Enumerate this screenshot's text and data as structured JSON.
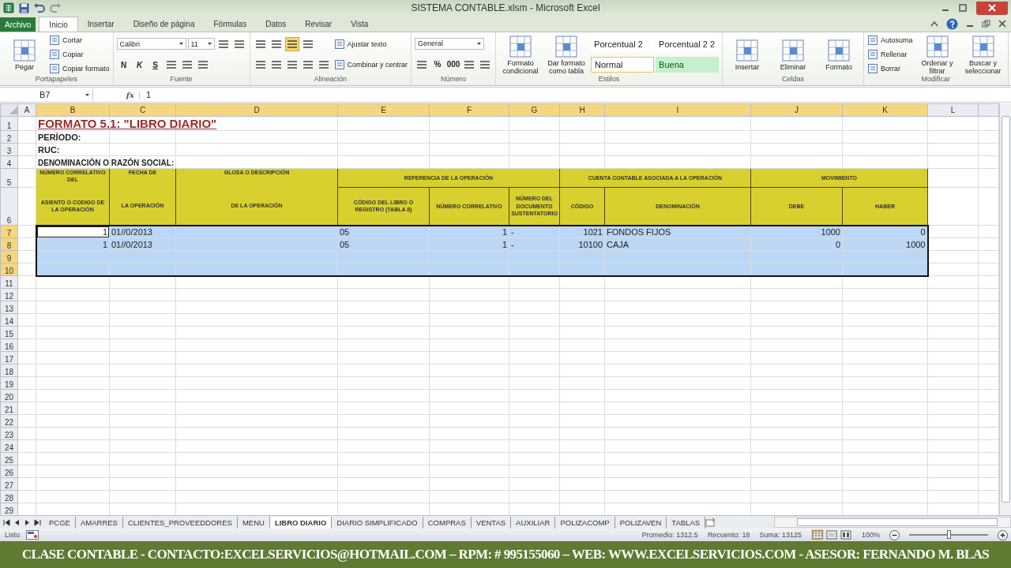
{
  "window": {
    "title": "SISTEMA CONTABLE.xlsm - Microsoft Excel"
  },
  "ribbon_tabs": [
    {
      "label": "Archivo",
      "kind": "file",
      "selected": false
    },
    {
      "label": "Inicio",
      "kind": "tab",
      "selected": true
    },
    {
      "label": "Insertar",
      "kind": "tab",
      "selected": false
    },
    {
      "label": "Diseño de página",
      "kind": "tab",
      "selected": false
    },
    {
      "label": "Fórmulas",
      "kind": "tab",
      "selected": false
    },
    {
      "label": "Datos",
      "kind": "tab",
      "selected": false
    },
    {
      "label": "Revisar",
      "kind": "tab",
      "selected": false
    },
    {
      "label": "Vista",
      "kind": "tab",
      "selected": false
    }
  ],
  "ribbon_groups": [
    {
      "label": "Portapapeles",
      "columns": [
        [
          [
            {
              "kind": "large",
              "label": "Pegar"
            }
          ]
        ],
        [
          [
            {
              "kind": "small",
              "label": "Cortar"
            }
          ],
          [
            {
              "kind": "small",
              "label": "Copiar"
            }
          ],
          [
            {
              "kind": "small",
              "label": "Copiar formato"
            }
          ]
        ]
      ]
    },
    {
      "label": "Fuente",
      "columns": [
        [
          [
            {
              "kind": "wide-field",
              "value": "Calibri"
            },
            {
              "kind": "narrow-field",
              "value": "11"
            },
            {
              "kind": "tool",
              "selected": false
            },
            {
              "kind": "tool",
              "selected": false
            }
          ],
          [
            {
              "kind": "bold-glyph",
              "label": "N",
              "selected": false
            },
            {
              "kind": "italic-glyph",
              "label": "K",
              "selected": false
            },
            {
              "kind": "underline-glyph",
              "label": "S",
              "selected": false
            },
            {
              "kind": "tool",
              "selected": false
            },
            {
              "kind": "tool",
              "selected": false
            },
            {
              "kind": "tool",
              "selected": false
            }
          ]
        ]
      ]
    },
    {
      "label": "Alineación",
      "columns": [
        [
          [
            {
              "kind": "tool",
              "selected": false
            },
            {
              "kind": "tool",
              "selected": false
            },
            {
              "kind": "tool",
              "selected": true
            },
            {
              "kind": "tool",
              "selected": false
            }
          ],
          [
            {
              "kind": "tool",
              "selected": false
            },
            {
              "kind": "tool",
              "selected": false
            },
            {
              "kind": "tool",
              "selected": false
            },
            {
              "kind": "tool",
              "selected": false
            },
            {
              "kind": "tool",
              "selected": false
            }
          ]
        ],
        [
          [
            {
              "kind": "small",
              "label": "Ajustar texto"
            }
          ],
          [
            {
              "kind": "small",
              "label": "Combinar y centrar"
            }
          ]
        ]
      ]
    },
    {
      "label": "Número",
      "columns": [
        [
          [
            {
              "kind": "wide-field",
              "value": "General"
            }
          ],
          [
            {
              "kind": "tool",
              "selected": false
            },
            {
              "kind": "bold-glyph",
              "label": "%",
              "selected": false
            },
            {
              "kind": "bold-glyph",
              "label": "000",
              "selected": false
            },
            {
              "kind": "tool",
              "selected": false
            },
            {
              "kind": "tool",
              "selected": false
            }
          ]
        ]
      ]
    },
    {
      "label": "Estilos",
      "columns": [
        [
          [
            {
              "kind": "large",
              "label": "Formato condicional"
            }
          ]
        ],
        [
          [
            {
              "kind": "large",
              "label": "Dar formato como tabla"
            }
          ]
        ],
        [
          [
            {
              "kind": "style",
              "label": "Porcentual 2",
              "selected": false
            },
            {
              "kind": "style",
              "label": "Porcentual 2 2",
              "selected": false
            }
          ],
          [
            {
              "kind": "style",
              "label": "Normal",
              "selected": true
            },
            {
              "kind": "style-good",
              "label": "Buena",
              "selected": false
            }
          ]
        ]
      ]
    },
    {
      "label": "Celdas",
      "columns": [
        [
          [
            {
              "kind": "large",
              "label": "Insertar"
            }
          ]
        ],
        [
          [
            {
              "kind": "large",
              "label": "Eliminar"
            }
          ]
        ],
        [
          [
            {
              "kind": "large",
              "label": "Formato"
            }
          ]
        ]
      ]
    },
    {
      "label": "Modificar",
      "columns": [
        [
          [
            {
              "kind": "small",
              "label": "Autosuma"
            }
          ],
          [
            {
              "kind": "small",
              "label": "Rellenar"
            }
          ],
          [
            {
              "kind": "small",
              "label": "Borrar"
            }
          ]
        ],
        [
          [
            {
              "kind": "large",
              "label": "Ordenar y filtrar"
            }
          ]
        ],
        [
          [
            {
              "kind": "large",
              "label": "Buscar y seleccionar"
            }
          ]
        ]
      ]
    }
  ],
  "formula_bar": {
    "name_box": "B7",
    "function_label": "fx",
    "formula": "1"
  },
  "sheet": {
    "columns": [
      {
        "letter": "A",
        "selected": false
      },
      {
        "letter": "B",
        "selected": true
      },
      {
        "letter": "C",
        "selected": true
      },
      {
        "letter": "D",
        "selected": true
      },
      {
        "letter": "E",
        "selected": true
      },
      {
        "letter": "F",
        "selected": true
      },
      {
        "letter": "G",
        "selected": true
      },
      {
        "letter": "H",
        "selected": true
      },
      {
        "letter": "I",
        "selected": true
      },
      {
        "letter": "J",
        "selected": true
      },
      {
        "letter": "K",
        "selected": true
      },
      {
        "letter": "L",
        "selected": false
      }
    ],
    "rows": [
      {
        "number": "1",
        "kind": "plain",
        "selected": false,
        "cells": [
          {
            "kind": "empty"
          },
          {
            "kind": "title",
            "text": "FORMATO 5.1: \"LIBRO DIARIO\""
          }
        ]
      },
      {
        "number": "2",
        "kind": "plain",
        "selected": false,
        "cells": [
          {
            "kind": "empty"
          },
          {
            "kind": "label",
            "text": "PERÍODO:"
          }
        ]
      },
      {
        "number": "3",
        "kind": "plain",
        "selected": false,
        "cells": [
          {
            "kind": "empty"
          },
          {
            "kind": "label",
            "text": "RUC:"
          }
        ]
      },
      {
        "number": "4",
        "kind": "plain",
        "selected": false,
        "cells": [
          {
            "kind": "empty"
          },
          {
            "kind": "label-small",
            "text": "DENOMINACIÓN O RAZÓN SOCIAL:"
          }
        ]
      },
      {
        "number": "5",
        "kind": "header-top",
        "selected": false,
        "cells": [
          {
            "kind": "empty"
          },
          {
            "kind": "header-top",
            "text": "NÚMERO CORRELATIVO DEL"
          },
          {
            "kind": "header-top",
            "text": "FECHA DE"
          },
          {
            "kind": "header-top",
            "text": "GLOSA O DESCRIPCIÓN"
          },
          {
            "kind": "group-start",
            "text": "REFERENCIA DE LA OPERACIÓN"
          },
          {
            "kind": "group-mid"
          },
          {
            "kind": "group-end"
          },
          {
            "kind": "group-start",
            "text": "CUENTA CONTABLE ASOCIADA A LA OPERACIÓN"
          },
          {
            "kind": "group-end"
          },
          {
            "kind": "group-start",
            "text": "MOVIMIENTO"
          },
          {
            "kind": "group-end"
          }
        ]
      },
      {
        "number": "6",
        "kind": "header",
        "selected": false,
        "cells": [
          {
            "kind": "empty"
          },
          {
            "kind": "header-bottom",
            "text": "ASIENTO O CODIGO DE LA OPERACIÓN"
          },
          {
            "kind": "header-bottom",
            "text": "LA OPERACIÓN"
          },
          {
            "kind": "header-bottom",
            "text": "DE LA OPERACIÓN"
          },
          {
            "kind": "header",
            "text": "CÓDIGO DEL LIBRO O REGISTRO (TABLA 8)"
          },
          {
            "kind": "header",
            "text": "NÚMERO CORRELATIVO"
          },
          {
            "kind": "header",
            "text": "NÚMERO DEL DOCUMENTO SUSTENTATORIO"
          },
          {
            "kind": "header",
            "text": "CÓDIGO"
          },
          {
            "kind": "header",
            "text": "DENOMINACIÓN"
          },
          {
            "kind": "header",
            "text": "DEBE"
          },
          {
            "kind": "header",
            "text": "HABER"
          }
        ]
      },
      {
        "number": "7",
        "kind": "data",
        "selected": true,
        "cells": [
          {
            "kind": "empty",
            "selected": false,
            "active": false
          },
          {
            "kind": "number",
            "text": "1",
            "selected": true,
            "active": true
          },
          {
            "kind": "text",
            "text": "01//0/2013",
            "selected": true,
            "active": false
          },
          {
            "kind": "empty",
            "selected": true,
            "active": false
          },
          {
            "kind": "text",
            "text": "05",
            "selected": true,
            "active": false
          },
          {
            "kind": "number",
            "text": "1",
            "selected": true,
            "active": false
          },
          {
            "kind": "text",
            "text": "-",
            "selected": true,
            "active": false
          },
          {
            "kind": "number",
            "text": "1021",
            "selected": true,
            "active": false
          },
          {
            "kind": "text",
            "text": "FONDOS FIJOS",
            "selected": true,
            "active": false
          },
          {
            "kind": "number",
            "text": "1000",
            "selected": true,
            "active": false
          },
          {
            "kind": "number",
            "text": "0",
            "selected": true,
            "active": false
          },
          {
            "kind": "empty",
            "selected": false,
            "active": false
          }
        ]
      },
      {
        "number": "8",
        "kind": "data",
        "selected": true,
        "cells": [
          {
            "kind": "empty",
            "selected": false,
            "active": false
          },
          {
            "kind": "number",
            "text": "1",
            "selected": true,
            "active": false
          },
          {
            "kind": "text",
            "text": "01//0/2013",
            "selected": true,
            "active": false
          },
          {
            "kind": "empty",
            "selected": true,
            "active": false
          },
          {
            "kind": "text",
            "text": "05",
            "selected": true,
            "active": false
          },
          {
            "kind": "number",
            "text": "1",
            "selected": true,
            "active": false
          },
          {
            "kind": "text",
            "text": "-",
            "selected": true,
            "active": false
          },
          {
            "kind": "number",
            "text": "10100",
            "selected": true,
            "active": false
          },
          {
            "kind": "text",
            "text": "CAJA",
            "selected": true,
            "active": false
          },
          {
            "kind": "number",
            "text": "0",
            "selected": true,
            "active": false
          },
          {
            "kind": "number",
            "text": "1000",
            "selected": true,
            "active": false
          },
          {
            "kind": "empty",
            "selected": false,
            "active": false
          }
        ]
      },
      {
        "number": "9",
        "kind": "data",
        "selected": true,
        "cells": [
          {
            "kind": "empty",
            "selected": false,
            "active": false
          },
          {
            "kind": "empty",
            "selected": true,
            "active": false
          },
          {
            "kind": "empty",
            "selected": true,
            "active": false
          },
          {
            "kind": "empty",
            "selected": true,
            "active": false
          },
          {
            "kind": "empty",
            "selected": true,
            "active": false
          },
          {
            "kind": "empty",
            "selected": true,
            "active": false
          },
          {
            "kind": "empty",
            "selected": true,
            "active": false
          },
          {
            "kind": "empty",
            "selected": true,
            "active": false
          },
          {
            "kind": "empty",
            "selected": true,
            "active": false
          },
          {
            "kind": "empty",
            "selected": true,
            "active": false
          },
          {
            "kind": "empty",
            "selected": true,
            "active": false
          },
          {
            "kind": "empty",
            "selected": false,
            "active": false
          }
        ]
      },
      {
        "number": "10",
        "kind": "data",
        "selected": true,
        "cells": [
          {
            "kind": "empty",
            "selected": false,
            "active": false
          },
          {
            "kind": "empty",
            "selected": true,
            "active": false
          },
          {
            "kind": "empty",
            "selected": true,
            "active": false
          },
          {
            "kind": "empty",
            "selected": true,
            "active": false
          },
          {
            "kind": "empty",
            "selected": true,
            "active": false
          },
          {
            "kind": "empty",
            "selected": true,
            "active": false
          },
          {
            "kind": "empty",
            "selected": true,
            "active": false
          },
          {
            "kind": "empty",
            "selected": true,
            "active": false
          },
          {
            "kind": "empty",
            "selected": true,
            "active": false
          },
          {
            "kind": "empty",
            "selected": true,
            "active": false
          },
          {
            "kind": "empty",
            "selected": true,
            "active": false
          },
          {
            "kind": "empty",
            "selected": false,
            "active": false
          }
        ]
      },
      {
        "number": "11",
        "kind": "plain",
        "selected": false
      },
      {
        "number": "12",
        "kind": "plain",
        "selected": false
      },
      {
        "number": "13",
        "kind": "plain",
        "selected": false
      },
      {
        "number": "14",
        "kind": "plain",
        "selected": false
      },
      {
        "number": "15",
        "kind": "plain",
        "selected": false
      },
      {
        "number": "16",
        "kind": "plain",
        "selected": false
      },
      {
        "number": "17",
        "kind": "plain",
        "selected": false
      },
      {
        "number": "18",
        "kind": "plain",
        "selected": false
      },
      {
        "number": "19",
        "kind": "plain",
        "selected": false
      },
      {
        "number": "20",
        "kind": "plain",
        "selected": false
      },
      {
        "number": "21",
        "kind": "plain",
        "selected": false
      },
      {
        "number": "22",
        "kind": "plain",
        "selected": false
      },
      {
        "number": "23",
        "kind": "plain",
        "selected": false
      },
      {
        "number": "24",
        "kind": "plain",
        "selected": false
      },
      {
        "number": "25",
        "kind": "plain",
        "selected": false
      },
      {
        "number": "26",
        "kind": "plain",
        "selected": false
      },
      {
        "number": "27",
        "kind": "plain",
        "selected": false
      },
      {
        "number": "28",
        "kind": "plain",
        "selected": false
      },
      {
        "number": "29",
        "kind": "plain",
        "selected": false
      }
    ]
  },
  "sheet_tabs": [
    {
      "label": "PCGE",
      "selected": false
    },
    {
      "label": "AMARRES",
      "selected": false
    },
    {
      "label": "CLIENTES_PROVEEDDORES",
      "selected": false
    },
    {
      "label": "MENU",
      "selected": false
    },
    {
      "label": "LIBRO DIARIO",
      "selected": true
    },
    {
      "label": "DIARIO SIMPLIFICADO",
      "selected": false
    },
    {
      "label": "COMPRAS",
      "selected": false
    },
    {
      "label": "VENTAS",
      "selected": false
    },
    {
      "label": "AUXILIAR",
      "selected": false
    },
    {
      "label": "POLIZACOMP",
      "selected": false
    },
    {
      "label": "POLIZAVEN",
      "selected": false
    },
    {
      "label": "TABLAS",
      "selected": false
    }
  ],
  "status_bar": {
    "mode": "Listo",
    "average": "Promedio: 1312.5",
    "count": "Recuento: 18",
    "sum": "Suma: 13125",
    "views": [
      {
        "kind": "normal",
        "selected": true
      },
      {
        "kind": "page-layout",
        "selected": false
      },
      {
        "kind": "page-break",
        "selected": false
      }
    ],
    "zoom": "100%",
    "zoom_level": {
      "level": 0.5
    }
  },
  "banner": {
    "text": "CLASE CONTABLE -  CONTACTO:EXCELSERVICIOS@HOTMAIL.COM – RPM: # 995155060 – WEB: WWW.EXCELSERVICIOS.COM - ASESOR: FERNANDO M. BLAS"
  }
}
